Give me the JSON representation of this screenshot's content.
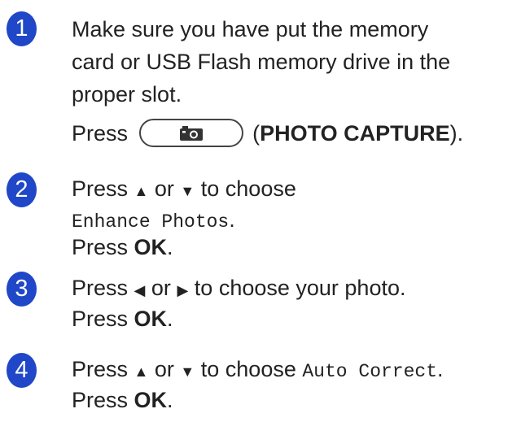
{
  "steps": [
    {
      "number": "1",
      "lines": [
        "Make sure you have put the memory",
        "card or USB Flash memory drive in the",
        "proper slot."
      ],
      "press": {
        "prefix": "Press",
        "paren_open": "(",
        "button_name": "PHOTO CAPTURE",
        "paren_close": ")."
      },
      "button_icon": "camera-icon"
    },
    {
      "number": "2",
      "line1": {
        "prefix": "Press",
        "up": "▲",
        "or": "or",
        "down": "▼",
        "suffix": "to choose"
      },
      "menu_item": "Enhance Photos",
      "menu_suffix": ".",
      "line3": {
        "prefix": "Press",
        "key": "OK",
        "suffix": "."
      }
    },
    {
      "number": "3",
      "line1": {
        "prefix": "Press",
        "left": "◀",
        "or": "or",
        "right": "▶",
        "suffix": "to choose your photo."
      },
      "line2": {
        "prefix": "Press",
        "key": "OK",
        "suffix": "."
      }
    },
    {
      "number": "4",
      "line1": {
        "prefix": "Press",
        "up": "▲",
        "or": "or",
        "down": "▼",
        "suffix": "to choose",
        "menu_item": "Auto Correct",
        "menu_suffix": "."
      },
      "line2": {
        "prefix": "Press",
        "key": "OK",
        "suffix": "."
      }
    }
  ],
  "colors": {
    "step_badge": "#1f47c8",
    "text": "#222222"
  }
}
